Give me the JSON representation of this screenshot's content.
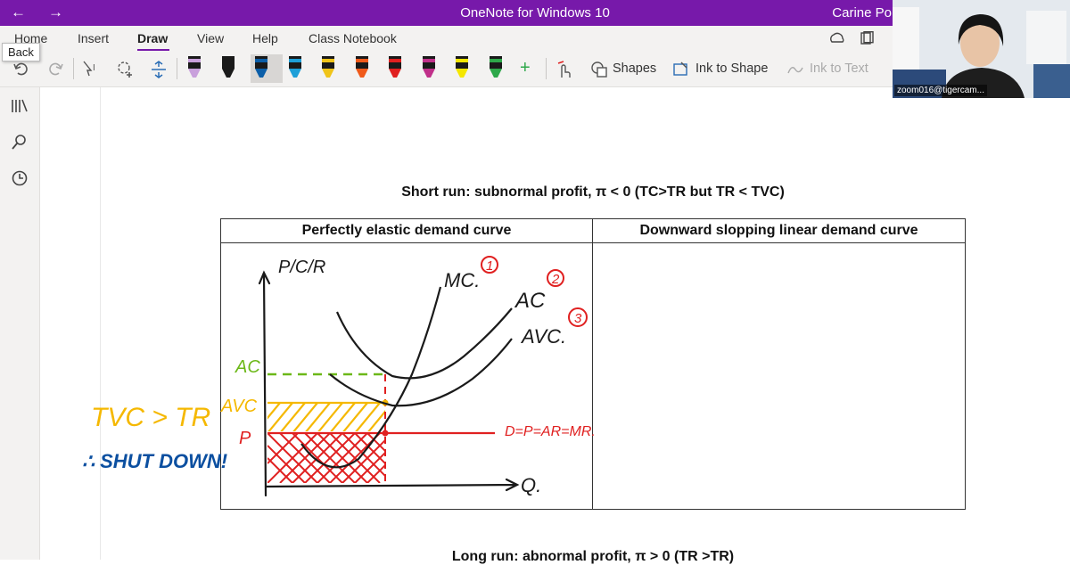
{
  "window": {
    "title": "OneNote for Windows 10",
    "user": "Carine Po"
  },
  "nav": {
    "back_icon": "←",
    "forward_icon": "→",
    "back_tooltip": "Back"
  },
  "ribbon": {
    "tabs": [
      "Home",
      "Insert",
      "Draw",
      "View",
      "Help",
      "Class Notebook"
    ],
    "active_tab": "Draw"
  },
  "toolbar": {
    "shapes_label": "Shapes",
    "ink_to_shape_label": "Ink to Shape",
    "ink_to_text_label": "Ink to Text",
    "add_pen": "+"
  },
  "pens": [
    {
      "color": "#1a1a1a",
      "tip": "#c9a0dc"
    },
    {
      "color": "#1a1a1a",
      "tip": "#1a1a1a"
    },
    {
      "color": "#1a1a1a",
      "tip": "#0b5ea8"
    },
    {
      "color": "#1a1a1a",
      "tip": "#1e9fd8"
    },
    {
      "color": "#1a1a1a",
      "tip": "#f0c419"
    },
    {
      "color": "#1a1a1a",
      "tip": "#f05a1a"
    },
    {
      "color": "#1a1a1a",
      "tip": "#e02020"
    },
    {
      "color": "#1a1a1a",
      "tip": "#c0308a"
    },
    {
      "color": "#1a1a1a",
      "tip": "#f5e700"
    },
    {
      "color": "#1a1a1a",
      "tip": "#2ea84a"
    }
  ],
  "page": {
    "heading_top": "Short run: subnormal profit, π < 0 (TC>TR but TR < TVC)",
    "table_headers": [
      "Perfectly elastic demand curve",
      "Downward slopping linear demand curve"
    ],
    "heading_bottom": "Long run: abnormal profit, π > 0 (TR >TR)"
  },
  "ink": {
    "yaxis": "P/C/R",
    "xaxis": "Q.",
    "mc": "MC.",
    "ac": "AC",
    "avc": "AVC.",
    "mc_num": "1",
    "ac_num": "2",
    "avc_num": "3",
    "ac_level": "AC",
    "avc_level": "AVC",
    "p_level": "P",
    "demand": "D=P=AR=MR.",
    "note_line1": "TVC > TR",
    "note_line2": "∴ SHUT DOWN!"
  },
  "webcam": {
    "caption": "zoom016@tigercam..."
  },
  "colors": {
    "brand": "#7719aa",
    "red_ink": "#e02020",
    "orange_ink": "#f5b800",
    "green_ink": "#6cb818",
    "blue_ink": "#0b4fa0"
  }
}
